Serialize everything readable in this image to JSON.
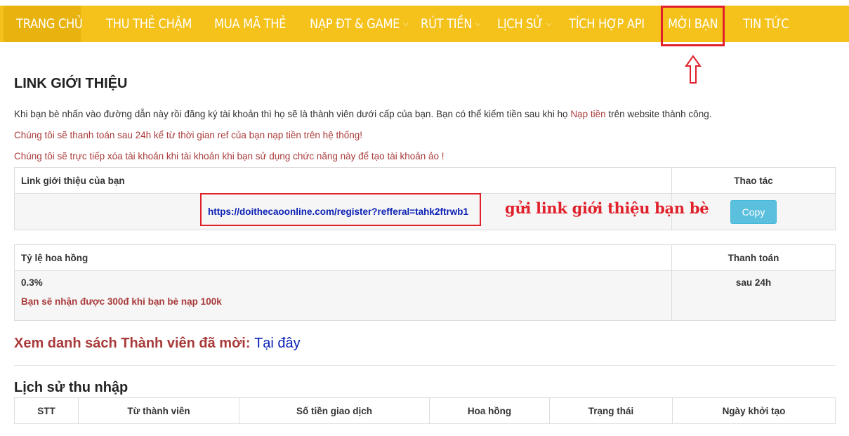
{
  "nav": {
    "items": [
      {
        "label": "TRANG CHỦ",
        "dropdown": false,
        "active": true
      },
      {
        "label": "THU THẺ CHẬM",
        "dropdown": false
      },
      {
        "label": "MUA MÃ THẺ",
        "dropdown": false
      },
      {
        "label": "NẠP ĐT & GAME",
        "dropdown": true
      },
      {
        "label": "RÚT TIỀN",
        "dropdown": true
      },
      {
        "label": "LỊCH SỬ",
        "dropdown": true
      },
      {
        "label": "TÍCH HỢP API",
        "dropdown": false
      },
      {
        "label": "MỜI BẠN",
        "dropdown": false
      },
      {
        "label": "TIN TỨC",
        "dropdown": false
      }
    ]
  },
  "page": {
    "title": "LINK GIỚI THIỆU",
    "desc_before": "Khi bạn bè nhấn vào đường dẫn này rồi đăng ký tài khoản thì họ sẽ là thành viên dưới cấp của bạn. Bạn có thể kiếm tiền sau khi họ ",
    "desc_link": "Nạp tiền",
    "desc_after": " trên website thành công.",
    "warn1": "Chúng tôi sẽ thanh toán sau 24h kể từ thời gian ref của bạn nạp tiền trên hệ thống!",
    "warn2": "Chúng tôi sẽ trực tiếp xóa tài khoản khi tài khoản khi bạn sử dụng chức năng này để tạo tài khoản ảo !"
  },
  "ref_table": {
    "col1": "Link giới thiệu của bạn",
    "col2": "Thao tác",
    "url": "https://doithecaoonline.com/register?refferal=tahk2ftrwb1",
    "copy_label": "Copy"
  },
  "annotation": {
    "note": "gửi link giới thiệu bạn bè"
  },
  "commission_table": {
    "col1": "Tỷ lệ hoa hồng",
    "col2": "Thanh toán",
    "rate": "0.3%",
    "earn_note": "Bạn sẽ nhận được 300đ khi bạn bè nạp 100k",
    "payment": "sau 24h"
  },
  "invite": {
    "label": "Xem danh sách Thành viên đã mời:",
    "link": "Tại đây"
  },
  "history": {
    "title": "Lịch sử thu nhập",
    "columns": [
      "STT",
      "Từ thành viên",
      "Số tiền giao dịch",
      "Hoa hồng",
      "Trạng thái",
      "Ngày khởi tạo"
    ]
  },
  "colors": {
    "nav_bg": "#f4c21b",
    "accent_red": "#e0202a",
    "link_blue": "#0a1fb4",
    "copy_btn": "#5bc0de"
  }
}
